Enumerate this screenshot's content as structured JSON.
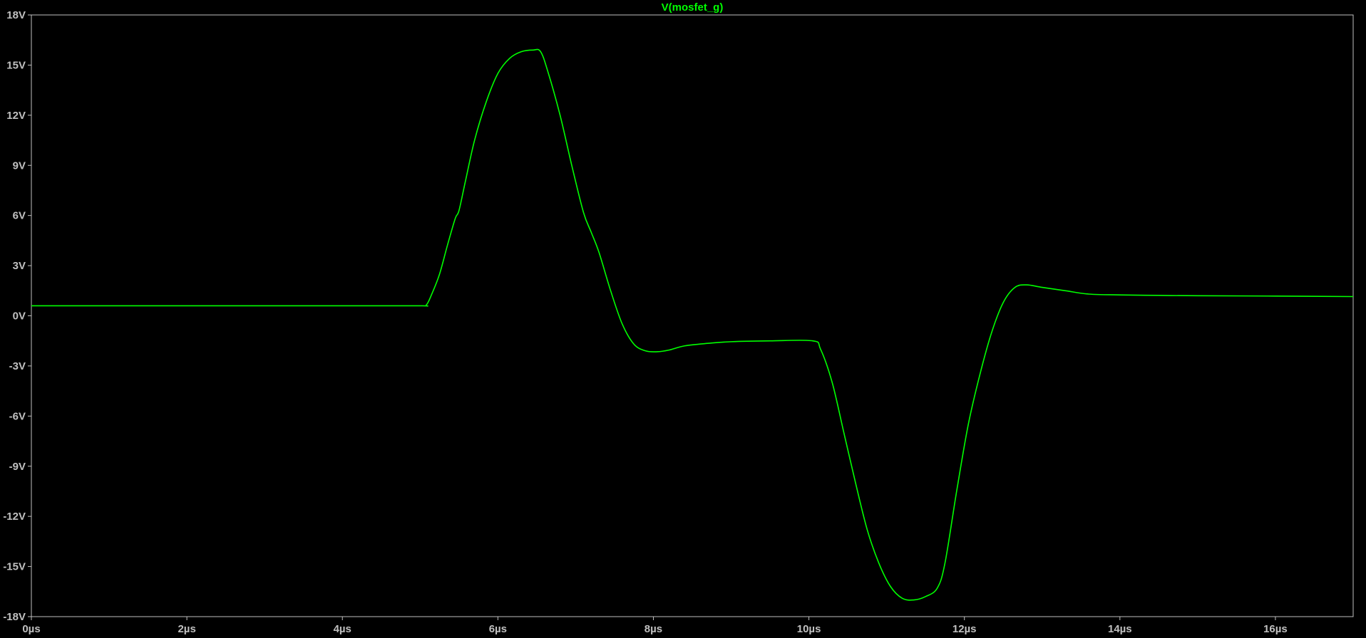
{
  "chart_data": {
    "type": "line",
    "xlabel": "",
    "ylabel": "",
    "xlim": [
      0,
      17
    ],
    "ylim": [
      -18,
      18
    ],
    "x_ticks": [
      0,
      2,
      4,
      6,
      8,
      10,
      12,
      14,
      16
    ],
    "x_tick_labels": [
      "0µs",
      "2µs",
      "4µs",
      "6µs",
      "8µs",
      "10µs",
      "12µs",
      "14µs",
      "16µs"
    ],
    "y_ticks": [
      18,
      15,
      12,
      9,
      6,
      3,
      0,
      -3,
      -6,
      -9,
      -12,
      -15,
      -18
    ],
    "y_tick_labels": [
      "18V",
      "15V",
      "12V",
      "9V",
      "6V",
      "3V",
      "0V",
      "-3V",
      "-6V",
      "-9V",
      "-12V",
      "-15V",
      "-18V"
    ],
    "grid": false,
    "colors": {
      "background": "#000000",
      "frame": "#c0c0c0",
      "tick_text": "#c0c0c0",
      "trace": "#00ff00"
    },
    "series": [
      {
        "name": "V(mosfet_g)",
        "color": "#00ff00",
        "points": [
          [
            0,
            0.6
          ],
          [
            1,
            0.6
          ],
          [
            2,
            0.6
          ],
          [
            3,
            0.6
          ],
          [
            4,
            0.6
          ],
          [
            5.0,
            0.6
          ],
          [
            5.08,
            0.65
          ],
          [
            5.15,
            1.3
          ],
          [
            5.25,
            2.5
          ],
          [
            5.35,
            4.2
          ],
          [
            5.45,
            5.8
          ],
          [
            5.5,
            6.3
          ],
          [
            5.58,
            8.0
          ],
          [
            5.7,
            10.5
          ],
          [
            5.85,
            12.8
          ],
          [
            6.0,
            14.5
          ],
          [
            6.15,
            15.4
          ],
          [
            6.3,
            15.8
          ],
          [
            6.45,
            15.9
          ],
          [
            6.55,
            15.8
          ],
          [
            6.65,
            14.5
          ],
          [
            6.8,
            12.0
          ],
          [
            6.95,
            9.0
          ],
          [
            7.1,
            6.2
          ],
          [
            7.2,
            5.0
          ],
          [
            7.3,
            3.8
          ],
          [
            7.45,
            1.5
          ],
          [
            7.6,
            -0.5
          ],
          [
            7.75,
            -1.7
          ],
          [
            7.9,
            -2.1
          ],
          [
            8.05,
            -2.15
          ],
          [
            8.2,
            -2.05
          ],
          [
            8.4,
            -1.8
          ],
          [
            8.7,
            -1.65
          ],
          [
            9.0,
            -1.55
          ],
          [
            9.5,
            -1.5
          ],
          [
            10.05,
            -1.5
          ],
          [
            10.15,
            -2.0
          ],
          [
            10.3,
            -4.0
          ],
          [
            10.45,
            -7.0
          ],
          [
            10.6,
            -10.0
          ],
          [
            10.75,
            -12.8
          ],
          [
            10.9,
            -14.8
          ],
          [
            11.05,
            -16.2
          ],
          [
            11.2,
            -16.9
          ],
          [
            11.35,
            -17.0
          ],
          [
            11.5,
            -16.8
          ],
          [
            11.65,
            -16.3
          ],
          [
            11.75,
            -14.8
          ],
          [
            11.9,
            -10.5
          ],
          [
            12.05,
            -6.5
          ],
          [
            12.2,
            -3.5
          ],
          [
            12.35,
            -1.0
          ],
          [
            12.5,
            0.8
          ],
          [
            12.65,
            1.7
          ],
          [
            12.8,
            1.85
          ],
          [
            13.0,
            1.7
          ],
          [
            13.3,
            1.5
          ],
          [
            13.6,
            1.3
          ],
          [
            14.0,
            1.25
          ],
          [
            14.5,
            1.22
          ],
          [
            15.0,
            1.2
          ],
          [
            16.0,
            1.18
          ],
          [
            17.0,
            1.15
          ]
        ]
      }
    ]
  }
}
